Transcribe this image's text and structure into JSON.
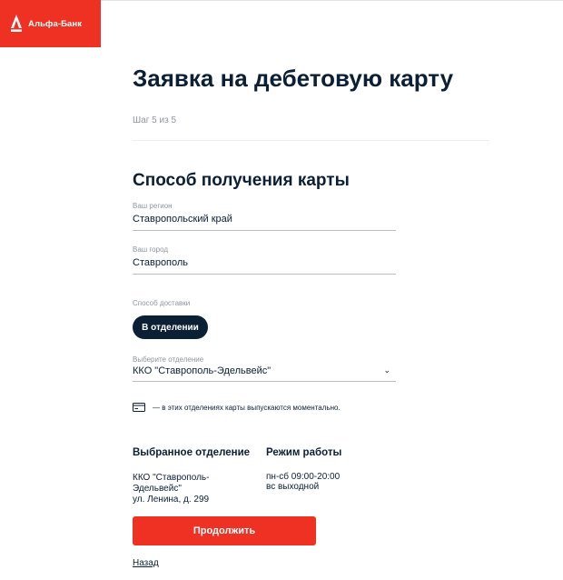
{
  "brand": {
    "name": "Альфа-Банк",
    "logo_color": "#ef3124"
  },
  "page": {
    "title": "Заявка на дебетовую карту",
    "step": "Шаг 5 из 5"
  },
  "section": {
    "title": "Способ получения карты"
  },
  "fields": {
    "region": {
      "label": "Ваш регион",
      "value": "Ставропольский край"
    },
    "city": {
      "label": "Ваш город",
      "value": "Ставрополь"
    },
    "delivery": {
      "label": "Способ доставки",
      "selected_option": "В отделении"
    },
    "branch": {
      "label": "Выберите отделение",
      "value": "ККО \"Ставрополь-Эдельвейс\"",
      "icon": "chevron-down-icon"
    }
  },
  "note": {
    "icon": "card-icon",
    "text": "— в этих отделениях карты выпускаются моментально."
  },
  "selected_office": {
    "heading": "Выбранное отделение",
    "name_line1": "ККО \"Ставрополь-",
    "name_line2": "Эдельвейс\"",
    "address": "ул. Ленина, д. 299"
  },
  "schedule": {
    "heading": "Режим работы",
    "line1": "пн-сб 09:00-20:00",
    "line2": "вс выходной"
  },
  "actions": {
    "continue_label": "Продолжить",
    "back_label": "Назад"
  },
  "colors": {
    "accent": "#ef3124",
    "dark": "#0b1f35",
    "muted": "#8f96a0"
  }
}
